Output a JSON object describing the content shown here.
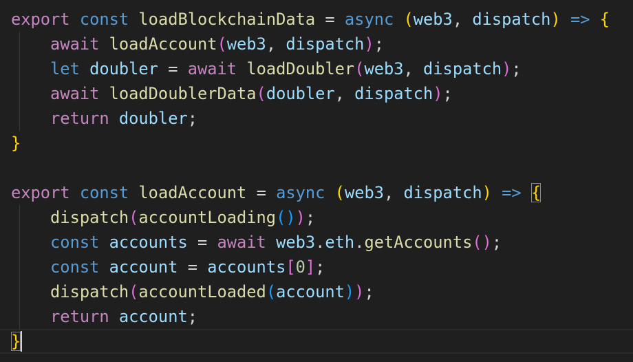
{
  "colors": {
    "background": "#1f1f1f",
    "keyword": "#c586c0",
    "storage": "#569cd6",
    "function": "#dcdcaa",
    "variable": "#9cdcfe",
    "plain": "#d4d4d4",
    "number": "#b5cea8",
    "bracket_gold": "#ffd700",
    "bracket_violet": "#da70d6",
    "bracket_blue": "#179fff"
  },
  "lines": [
    [
      {
        "t": "export",
        "c": "keyword"
      },
      {
        "t": " ",
        "c": "plain"
      },
      {
        "t": "const",
        "c": "storage"
      },
      {
        "t": " ",
        "c": "plain"
      },
      {
        "t": "loadBlockchainData",
        "c": "function"
      },
      {
        "t": " ",
        "c": "plain"
      },
      {
        "t": "=",
        "c": "plain"
      },
      {
        "t": " ",
        "c": "plain"
      },
      {
        "t": "async",
        "c": "storage"
      },
      {
        "t": " ",
        "c": "plain"
      },
      {
        "t": "(",
        "c": "bracket_gold"
      },
      {
        "t": "web3",
        "c": "variable"
      },
      {
        "t": ", ",
        "c": "plain"
      },
      {
        "t": "dispatch",
        "c": "variable"
      },
      {
        "t": ")",
        "c": "bracket_gold"
      },
      {
        "t": " ",
        "c": "plain"
      },
      {
        "t": "=>",
        "c": "storage"
      },
      {
        "t": " ",
        "c": "plain"
      },
      {
        "t": "{",
        "c": "bracket_gold"
      }
    ],
    [
      {
        "t": "    ",
        "c": "plain"
      },
      {
        "t": "await",
        "c": "keyword"
      },
      {
        "t": " ",
        "c": "plain"
      },
      {
        "t": "loadAccount",
        "c": "function"
      },
      {
        "t": "(",
        "c": "bracket_violet"
      },
      {
        "t": "web3",
        "c": "variable"
      },
      {
        "t": ", ",
        "c": "plain"
      },
      {
        "t": "dispatch",
        "c": "variable"
      },
      {
        "t": ")",
        "c": "bracket_violet"
      },
      {
        "t": ";",
        "c": "plain"
      }
    ],
    [
      {
        "t": "    ",
        "c": "plain"
      },
      {
        "t": "let",
        "c": "storage"
      },
      {
        "t": " ",
        "c": "plain"
      },
      {
        "t": "doubler",
        "c": "variable"
      },
      {
        "t": " ",
        "c": "plain"
      },
      {
        "t": "=",
        "c": "plain"
      },
      {
        "t": " ",
        "c": "plain"
      },
      {
        "t": "await",
        "c": "keyword"
      },
      {
        "t": " ",
        "c": "plain"
      },
      {
        "t": "loadDoubler",
        "c": "function"
      },
      {
        "t": "(",
        "c": "bracket_violet"
      },
      {
        "t": "web3",
        "c": "variable"
      },
      {
        "t": ", ",
        "c": "plain"
      },
      {
        "t": "dispatch",
        "c": "variable"
      },
      {
        "t": ")",
        "c": "bracket_violet"
      },
      {
        "t": ";",
        "c": "plain"
      }
    ],
    [
      {
        "t": "    ",
        "c": "plain"
      },
      {
        "t": "await",
        "c": "keyword"
      },
      {
        "t": " ",
        "c": "plain"
      },
      {
        "t": "loadDoublerData",
        "c": "function"
      },
      {
        "t": "(",
        "c": "bracket_violet"
      },
      {
        "t": "doubler",
        "c": "variable"
      },
      {
        "t": ", ",
        "c": "plain"
      },
      {
        "t": "dispatch",
        "c": "variable"
      },
      {
        "t": ")",
        "c": "bracket_violet"
      },
      {
        "t": ";",
        "c": "plain"
      }
    ],
    [
      {
        "t": "    ",
        "c": "plain"
      },
      {
        "t": "return",
        "c": "keyword"
      },
      {
        "t": " ",
        "c": "plain"
      },
      {
        "t": "doubler",
        "c": "variable"
      },
      {
        "t": ";",
        "c": "plain"
      }
    ],
    [
      {
        "t": "}",
        "c": "bracket_gold"
      }
    ],
    [],
    [
      {
        "t": "export",
        "c": "keyword"
      },
      {
        "t": " ",
        "c": "plain"
      },
      {
        "t": "const",
        "c": "storage"
      },
      {
        "t": " ",
        "c": "plain"
      },
      {
        "t": "loadAccount",
        "c": "function"
      },
      {
        "t": " ",
        "c": "plain"
      },
      {
        "t": "=",
        "c": "plain"
      },
      {
        "t": " ",
        "c": "plain"
      },
      {
        "t": "async",
        "c": "storage"
      },
      {
        "t": " ",
        "c": "plain"
      },
      {
        "t": "(",
        "c": "bracket_gold"
      },
      {
        "t": "web3",
        "c": "variable"
      },
      {
        "t": ", ",
        "c": "plain"
      },
      {
        "t": "dispatch",
        "c": "variable"
      },
      {
        "t": ")",
        "c": "bracket_gold"
      },
      {
        "t": " ",
        "c": "plain"
      },
      {
        "t": "=>",
        "c": "storage"
      },
      {
        "t": " ",
        "c": "plain"
      },
      {
        "t": "{",
        "c": "bracket_gold",
        "box": true
      }
    ],
    [
      {
        "t": "    ",
        "c": "plain"
      },
      {
        "t": "dispatch",
        "c": "function"
      },
      {
        "t": "(",
        "c": "bracket_violet"
      },
      {
        "t": "accountLoading",
        "c": "function"
      },
      {
        "t": "(",
        "c": "bracket_blue"
      },
      {
        "t": ")",
        "c": "bracket_blue"
      },
      {
        "t": ")",
        "c": "bracket_violet"
      },
      {
        "t": ";",
        "c": "plain"
      }
    ],
    [
      {
        "t": "    ",
        "c": "plain"
      },
      {
        "t": "const",
        "c": "storage"
      },
      {
        "t": " ",
        "c": "plain"
      },
      {
        "t": "accounts",
        "c": "variable"
      },
      {
        "t": " ",
        "c": "plain"
      },
      {
        "t": "=",
        "c": "plain"
      },
      {
        "t": " ",
        "c": "plain"
      },
      {
        "t": "await",
        "c": "keyword"
      },
      {
        "t": " ",
        "c": "plain"
      },
      {
        "t": "web3",
        "c": "variable"
      },
      {
        "t": ".",
        "c": "plain"
      },
      {
        "t": "eth",
        "c": "variable"
      },
      {
        "t": ".",
        "c": "plain"
      },
      {
        "t": "getAccounts",
        "c": "function"
      },
      {
        "t": "(",
        "c": "bracket_violet"
      },
      {
        "t": ")",
        "c": "bracket_violet"
      },
      {
        "t": ";",
        "c": "plain"
      }
    ],
    [
      {
        "t": "    ",
        "c": "plain"
      },
      {
        "t": "const",
        "c": "storage"
      },
      {
        "t": " ",
        "c": "plain"
      },
      {
        "t": "account",
        "c": "variable"
      },
      {
        "t": " ",
        "c": "plain"
      },
      {
        "t": "=",
        "c": "plain"
      },
      {
        "t": " ",
        "c": "plain"
      },
      {
        "t": "accounts",
        "c": "variable"
      },
      {
        "t": "[",
        "c": "bracket_violet"
      },
      {
        "t": "0",
        "c": "number"
      },
      {
        "t": "]",
        "c": "bracket_violet"
      },
      {
        "t": ";",
        "c": "plain"
      }
    ],
    [
      {
        "t": "    ",
        "c": "plain"
      },
      {
        "t": "dispatch",
        "c": "function"
      },
      {
        "t": "(",
        "c": "bracket_violet"
      },
      {
        "t": "accountLoaded",
        "c": "function"
      },
      {
        "t": "(",
        "c": "bracket_blue"
      },
      {
        "t": "account",
        "c": "variable"
      },
      {
        "t": ")",
        "c": "bracket_blue"
      },
      {
        "t": ")",
        "c": "bracket_violet"
      },
      {
        "t": ";",
        "c": "plain"
      }
    ],
    [
      {
        "t": "    ",
        "c": "plain"
      },
      {
        "t": "return",
        "c": "keyword"
      },
      {
        "t": " ",
        "c": "plain"
      },
      {
        "t": "account",
        "c": "variable"
      },
      {
        "t": ";",
        "c": "plain"
      }
    ],
    [
      {
        "t": "}",
        "c": "bracket_gold",
        "box": true
      }
    ]
  ]
}
